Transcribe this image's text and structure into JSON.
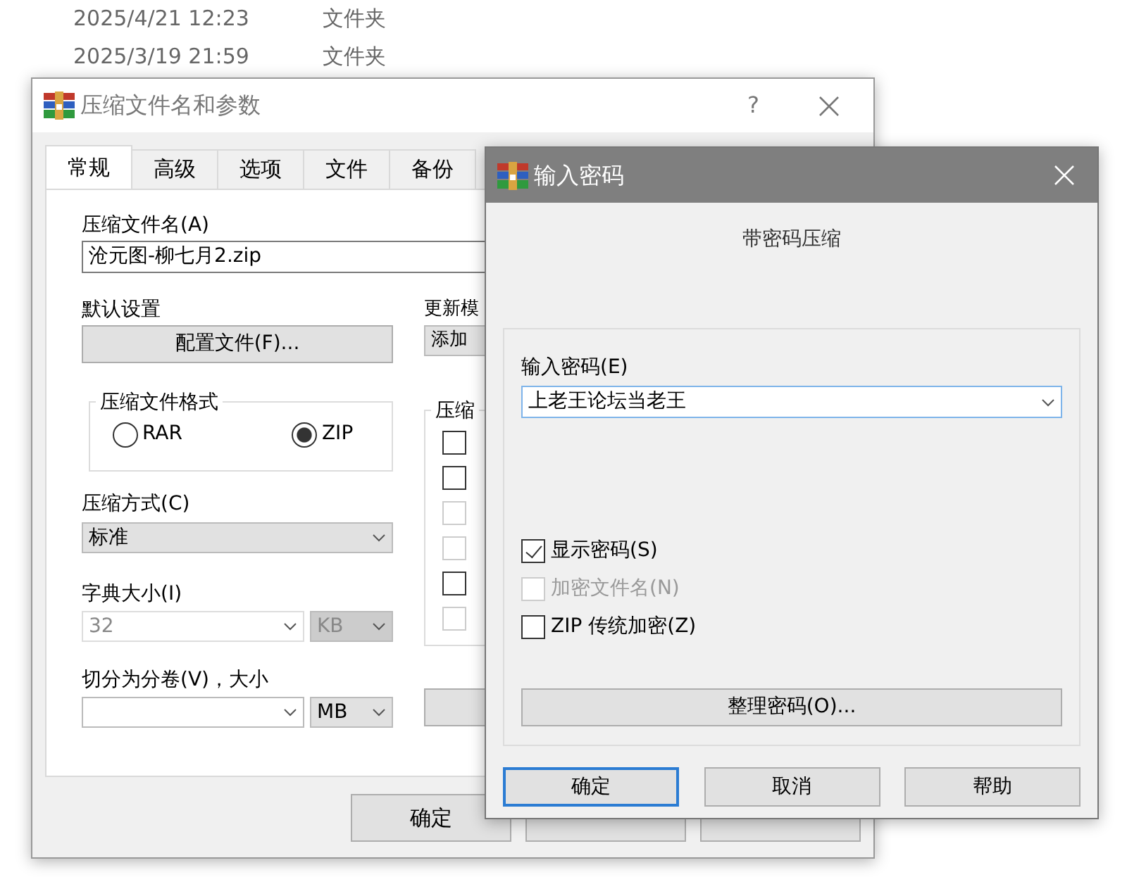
{
  "background_list": [
    {
      "date": "2025/4/21 12:23",
      "type": "文件夹"
    },
    {
      "date": "2025/3/19 21:59",
      "type": "文件夹"
    }
  ],
  "main_dialog": {
    "title": "压缩文件名和参数",
    "help_glyph": "?",
    "tabs": [
      {
        "label": "常规",
        "selected": true
      },
      {
        "label": "高级",
        "selected": false
      },
      {
        "label": "选项",
        "selected": false
      },
      {
        "label": "文件",
        "selected": false
      },
      {
        "label": "备份",
        "selected": false
      }
    ],
    "archive_name": {
      "label": "压缩文件名(A)",
      "value": "沧元图-柳七月2.zip"
    },
    "default_settings": {
      "label": "默认设置",
      "button": "配置文件(F)..."
    },
    "update_mode": {
      "label": "更新模",
      "value": "添加"
    },
    "format": {
      "legend": "压缩文件格式",
      "options": [
        {
          "label": "RAR",
          "selected": false
        },
        {
          "label": "ZIP",
          "selected": true
        }
      ]
    },
    "method": {
      "label": "压缩方式(C)",
      "value": "标准"
    },
    "dictionary": {
      "label": "字典大小(I)",
      "value": "32",
      "unit": "KB",
      "disabled": true
    },
    "volumes": {
      "label": "切分为分卷(V)，大小",
      "unit": "MB"
    },
    "options": {
      "legend": "压缩",
      "items": [
        {
          "checked": false,
          "disabled": false
        },
        {
          "checked": false,
          "disabled": false
        },
        {
          "checked": false,
          "disabled": true
        },
        {
          "checked": false,
          "disabled": true
        },
        {
          "checked": false,
          "disabled": false
        },
        {
          "checked": false,
          "disabled": true
        }
      ]
    },
    "ok_button": "确定"
  },
  "password_dialog": {
    "title": "输入密码",
    "heading": "带密码压缩",
    "password": {
      "label": "输入密码(E)",
      "value": "上老王论坛当老王"
    },
    "checkboxes": [
      {
        "label": "显示密码(S)",
        "checked": true,
        "disabled": false
      },
      {
        "label": "加密文件名(N)",
        "checked": false,
        "disabled": true
      },
      {
        "label": "ZIP 传统加密(Z)",
        "checked": false,
        "disabled": false
      }
    ],
    "manage_button": "整理密码(O)...",
    "buttons": [
      {
        "label": "确定",
        "default": true
      },
      {
        "label": "取消",
        "default": false
      },
      {
        "label": "帮助",
        "default": false
      }
    ]
  }
}
